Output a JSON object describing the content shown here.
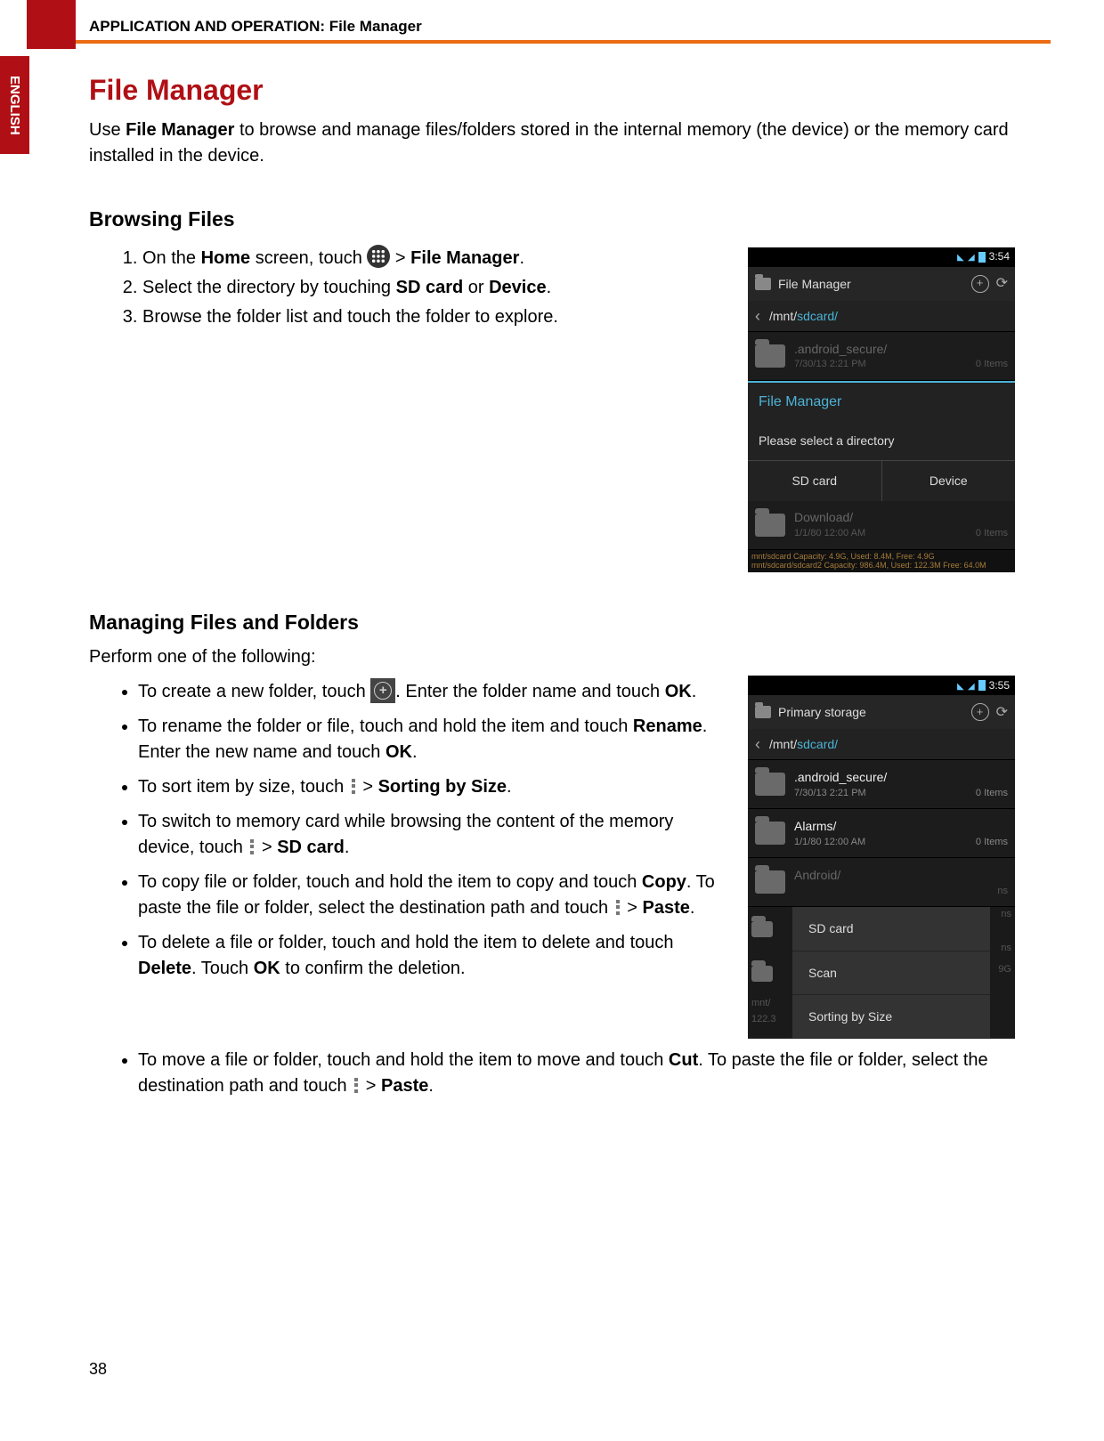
{
  "header": "APPLICATION AND OPERATION: File Manager",
  "lang_tab": "ENGLISH",
  "page_number": "38",
  "title": "File Manager",
  "intro_parts": {
    "a": "Use ",
    "b": "File Manager",
    "c": " to browse and manage files/folders stored in the internal memory (the device) or the memory card installed in the device."
  },
  "section1": {
    "heading": "Browsing Files",
    "steps": {
      "s1a": "On the ",
      "s1b": "Home",
      "s1c": " screen, touch ",
      "s1d": " > ",
      "s1e": "File Manager",
      "s1f": ".",
      "s2a": "Select the directory by touching ",
      "s2b": "SD card",
      "s2c": " or ",
      "s2d": "Device",
      "s2e": ".",
      "s3": "Browse the folder list and touch the folder to explore."
    }
  },
  "section2": {
    "heading": "Managing Files and Folders",
    "lead": "Perform one of the following:",
    "bullets": {
      "b1a": "To create a new folder, touch ",
      "b1b": ". Enter the folder name and touch ",
      "b1c": "OK",
      "b1d": ".",
      "b2a": "To rename the folder or file, touch and hold the item and touch ",
      "b2b": "Rename",
      "b2c": ". Enter the new name and touch ",
      "b2d": "OK",
      "b2e": ".",
      "b3a": "To sort item by size, touch ",
      "b3b": " > ",
      "b3c": "Sorting by Size",
      "b3d": ".",
      "b4a": "To switch to memory card while browsing the content of the memory device, touch ",
      "b4b": " > ",
      "b4c": "SD card",
      "b4d": ".",
      "b5a": "To copy file or folder, touch and hold the item to copy and touch ",
      "b5b": "Copy",
      "b5c": ". To paste the file or folder, select the destination path and touch ",
      "b5d": " > ",
      "b5e": "Paste",
      "b5f": ".",
      "b6a": "To delete a file or folder, touch and hold the item to delete and touch ",
      "b6b": "Delete",
      "b6c": ". Touch ",
      "b6d": "OK",
      "b6e": " to confirm the deletion.",
      "b7a": "To move a file or folder, touch and hold the item to move and touch ",
      "b7b": "Cut",
      "b7c": ". To paste the file or folder, select the destination path and touch ",
      "b7d": " > ",
      "b7e": "Paste",
      "b7f": "."
    }
  },
  "phone1": {
    "time": "3:54",
    "app_title": "File Manager",
    "path_prefix": "/mnt/",
    "path_hl": "sdcard/",
    "row1_name": ".android_secure/",
    "row1_date": "7/30/13 2:21 PM",
    "row1_items": "0 Items",
    "popup_title": "File Manager",
    "popup_msg": "Please select a directory",
    "popup_btn1": "SD card",
    "popup_btn2": "Device",
    "row2_name": "Download/",
    "row2_date": "1/1/80 12:00 AM",
    "row2_items": "0 Items",
    "stats1": "mnt/sdcard  Capacity: 4.9G, Used: 8.4M, Free: 4.9G",
    "stats2": "mnt/sdcard/sdcard2  Capacity: 986.4M, Used: 122.3M  Free: 64.0M"
  },
  "phone2": {
    "time": "3:55",
    "app_title": "Primary storage",
    "path_prefix": "/mnt/",
    "path_hl": "sdcard/",
    "row1_name": ".android_secure/",
    "row1_date": "7/30/13 2:21 PM",
    "row1_items": "0 Items",
    "row2_name": "Alarms/",
    "row2_date": "1/1/80 12:00 AM",
    "row2_items": "0 Items",
    "row3_name": "Android/",
    "row3_tail": "ns",
    "menu_sd": "SD card",
    "menu_scan": "Scan",
    "menu_sort": "Sorting by Size",
    "left_frag1": "mnt/",
    "left_frag2": "122.3",
    "right_frag1": "ns",
    "right_frag2": "ns",
    "right_frag3": "9G"
  }
}
